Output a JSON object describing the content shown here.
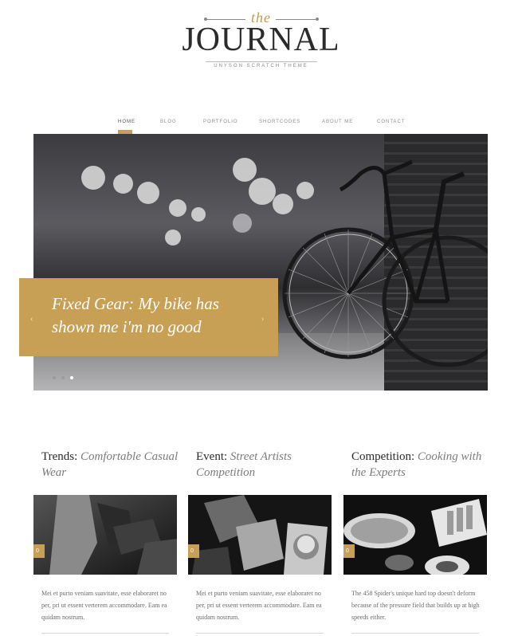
{
  "logo": {
    "the": "the",
    "main": "JOURNAL",
    "tagline": "UNYSON SCRATCH THEME"
  },
  "nav": {
    "items": [
      "HOME",
      "BLOG",
      "PORTFOLIO",
      "SHORTCODES",
      "ABOUT ME",
      "CONTACT"
    ],
    "active_index": 0
  },
  "hero": {
    "title": "Fixed Gear: My bike has shown me i'm no good",
    "prev_icon": "chevron-left-icon",
    "next_icon": "chevron-right-icon",
    "slide_count": 3,
    "active_slide": 2
  },
  "posts": [
    {
      "category": "Trends:",
      "title": "Comfortable Casual Wear",
      "comments": "0",
      "excerpt": "Mei et purto veniam suavitate, esse elaboraret no per, pri ut essent verterem accommodare. Eam ea quidam nostrum."
    },
    {
      "category": "Event:",
      "title": "Street Artists Competition",
      "comments": "0",
      "excerpt": "Mei et purto veniam suavitate, esse elaboraret no per, pri ut essent verterem accommodare. Eam ea quidam nostrum."
    },
    {
      "category": "Competition:",
      "title": "Cooking with the Experts",
      "comments": "0",
      "excerpt": "The 458 Spider's unique hard top doesn't deform because of the pressure field that builds up at high speeds either."
    }
  ],
  "colors": {
    "accent": "#c8a055",
    "text": "#2a2a2a",
    "muted": "#7c7c7c"
  }
}
